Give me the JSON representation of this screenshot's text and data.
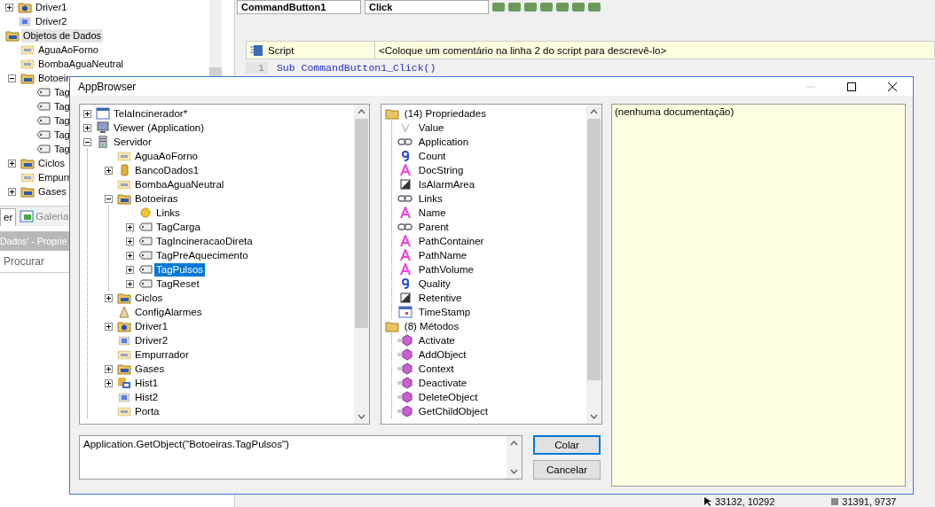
{
  "left_tree": {
    "items": [
      {
        "label": "Driver1",
        "kind": "driver",
        "expanded": false,
        "selected": false
      },
      {
        "label": "Driver2",
        "kind": "driver2",
        "selected": false
      },
      {
        "label": "Objetos de Dados",
        "kind": "folder",
        "selected": true,
        "children": [
          {
            "label": "AguaAoForno",
            "kind": "dataobj",
            "selected": false
          },
          {
            "label": "BombaAguaNeutral",
            "kind": "dataobj",
            "selected": false
          },
          {
            "label": "Botoeir",
            "kind": "folder",
            "expanded": true,
            "selected": false,
            "children": [
              {
                "label": "Tag",
                "kind": "tag",
                "selected": false
              },
              {
                "label": "Tag",
                "kind": "tag",
                "selected": false
              },
              {
                "label": "Tag",
                "kind": "tag",
                "selected": false
              },
              {
                "label": "Tag",
                "kind": "tag",
                "selected": false
              },
              {
                "label": "Tag",
                "kind": "tag",
                "selected": false
              }
            ]
          },
          {
            "label": "Ciclos",
            "kind": "folder",
            "expanded": false,
            "selected": false
          },
          {
            "label": "Empurr",
            "kind": "dataobj",
            "selected": false
          },
          {
            "label": "Gases",
            "kind": "folder",
            "expanded": false,
            "selected": false
          }
        ]
      }
    ]
  },
  "left_tabs": [
    {
      "label": "er",
      "selected": true
    },
    {
      "label": "Galeria",
      "selected": false
    }
  ],
  "properties_panel": {
    "title": "Dados' - Proprie",
    "search": {
      "placeholder": "Procurar"
    }
  },
  "editor": {
    "object_combo": "CommandButton1",
    "event_combo": "Click",
    "script_header": {
      "label": "Script",
      "comment": "<Coloque um comentário na linha 2 do script para descrevê-lo>"
    },
    "line_number": "1",
    "code": "Sub CommandButton1_Click()"
  },
  "status_bar": [
    "33132, 10292",
    "31391, 9737"
  ],
  "dialog": {
    "title": "AppBrowser",
    "tree": [
      {
        "label": "TelaIncinerador*",
        "kind": "window",
        "expanded": false,
        "selected": false
      },
      {
        "label": "Viewer (Application)",
        "kind": "monitor",
        "expanded": false,
        "selected": false
      },
      {
        "label": "Servidor",
        "kind": "server",
        "expanded": true,
        "selected": false,
        "children": [
          {
            "label": "AguaAoForno",
            "kind": "dataobj",
            "selected": false
          },
          {
            "label": "BancoDados1",
            "kind": "db",
            "expanded": false,
            "selected": false
          },
          {
            "label": "BombaAguaNeutral",
            "kind": "dataobj",
            "selected": false
          },
          {
            "label": "Botoeiras",
            "kind": "folder",
            "expanded": true,
            "selected": false,
            "children": [
              {
                "label": "Links",
                "kind": "circle",
                "selected": false
              },
              {
                "label": "TagCarga",
                "kind": "tag",
                "expanded": false,
                "selected": false
              },
              {
                "label": "TagIncineracaoDireta",
                "kind": "tag",
                "expanded": false,
                "selected": false
              },
              {
                "label": "TagPreAquecimento",
                "kind": "tag",
                "expanded": false,
                "selected": false
              },
              {
                "label": "TagPulsos",
                "kind": "tag",
                "expanded": false,
                "selected": true
              },
              {
                "label": "TagReset",
                "kind": "tag",
                "expanded": false,
                "selected": false
              }
            ]
          },
          {
            "label": "Ciclos",
            "kind": "folder",
            "expanded": false,
            "selected": false
          },
          {
            "label": "ConfigAlarmes",
            "kind": "alarm",
            "selected": false
          },
          {
            "label": "Driver1",
            "kind": "driver",
            "expanded": false,
            "selected": false
          },
          {
            "label": "Driver2",
            "kind": "driver2",
            "selected": false
          },
          {
            "label": "Empurrador",
            "kind": "dataobj",
            "selected": false
          },
          {
            "label": "Gases",
            "kind": "folder",
            "expanded": false,
            "selected": false
          },
          {
            "label": "Hist1",
            "kind": "hist",
            "expanded": false,
            "selected": false
          },
          {
            "label": "Hist2",
            "kind": "driver2",
            "selected": false
          },
          {
            "label": "Porta",
            "kind": "dataobj",
            "selected": false
          }
        ]
      }
    ],
    "members": [
      {
        "label": "(14) Propriedades",
        "items": [
          {
            "name": "Value",
            "kind": "event",
            "selected": false
          },
          {
            "name": "Application",
            "kind": "link",
            "selected": false
          },
          {
            "name": "Count",
            "kind": "number",
            "selected": false
          },
          {
            "name": "DocString",
            "kind": "string",
            "selected": false
          },
          {
            "name": "IsAlarmArea",
            "kind": "bool",
            "selected": false
          },
          {
            "name": "Links",
            "kind": "link",
            "selected": false
          },
          {
            "name": "Name",
            "kind": "string",
            "selected": false
          },
          {
            "name": "Parent",
            "kind": "link",
            "selected": false
          },
          {
            "name": "PathContainer",
            "kind": "string",
            "selected": false
          },
          {
            "name": "PathName",
            "kind": "string",
            "selected": false
          },
          {
            "name": "PathVolume",
            "kind": "string",
            "selected": false
          },
          {
            "name": "Quality",
            "kind": "number",
            "selected": false
          },
          {
            "name": "Retentive",
            "kind": "bool",
            "selected": false
          },
          {
            "name": "TimeStamp",
            "kind": "date",
            "selected": false
          }
        ]
      },
      {
        "label": "(8) Métodos",
        "items": [
          {
            "name": "Activate",
            "kind": "method",
            "selected": false
          },
          {
            "name": "AddObject",
            "kind": "method",
            "selected": false
          },
          {
            "name": "Context",
            "kind": "method",
            "selected": false
          },
          {
            "name": "Deactivate",
            "kind": "method",
            "selected": false
          },
          {
            "name": "DeleteObject",
            "kind": "method",
            "selected": false
          },
          {
            "name": "GetChildObject",
            "kind": "method",
            "selected": false
          }
        ]
      }
    ],
    "documentation": "(nenhuma documentação)",
    "expression": "Application.GetObject(\"Botoeiras.TagPulsos\")",
    "buttons": [
      "Colar",
      "Cancelar"
    ]
  }
}
